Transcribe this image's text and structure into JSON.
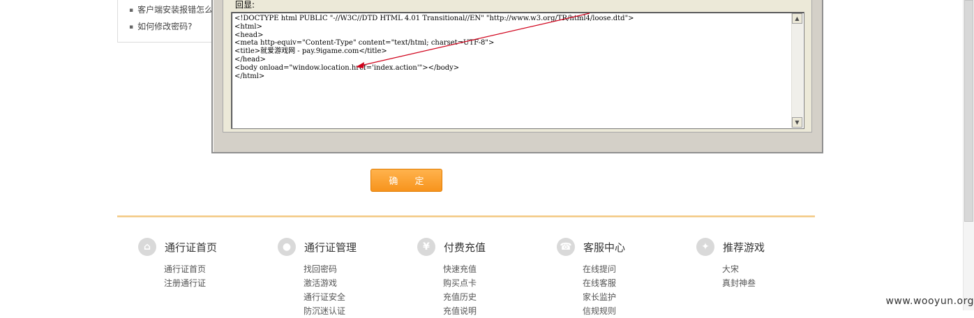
{
  "help_list": {
    "items": [
      "客户端安装报错怎么办",
      "如何修改密码?"
    ]
  },
  "dialog": {
    "label": "回显:",
    "response_lines": [
      "<!DOCTYPE html PUBLIC \"-//W3C//DTD HTML 4.01 Transitional//EN\" \"http://www.w3.org/TR/html4/loose.dtd\">",
      "<html>",
      "<head>",
      "<meta http-equiv=\"Content-Type\" content=\"text/html; charset=UTF-8\">",
      "<title>就爱游戏网 - pay.9igame.com</title>",
      "</head>",
      "<body onload=\"window.location.href='index.action'\"></body>",
      "</html>"
    ]
  },
  "confirm_button": {
    "label": "确 定"
  },
  "footer": {
    "columns": [
      {
        "icon": "home-icon",
        "title": "通行证首页",
        "links": [
          "通行证首页",
          "注册通行证"
        ]
      },
      {
        "icon": "user-icon",
        "title": "通行证管理",
        "links": [
          "找回密码",
          "激活游戏",
          "通行证安全",
          "防沉迷认证"
        ]
      },
      {
        "icon": "yen-icon",
        "title": "付费充值",
        "links": [
          "快速充值",
          "购买点卡",
          "充值历史",
          "充值说明"
        ]
      },
      {
        "icon": "phone-icon",
        "title": "客服中心",
        "links": [
          "在线提问",
          "在线客服",
          "家长监护",
          "信规规则"
        ]
      },
      {
        "icon": "game-icon",
        "title": "推荐游戏",
        "links": [
          "大宋",
          "真封神叁"
        ]
      }
    ]
  },
  "watermark": "www.wooyun.org",
  "colors": {
    "accent": "#f7941d",
    "annotation_arrow": "#d0021b"
  }
}
